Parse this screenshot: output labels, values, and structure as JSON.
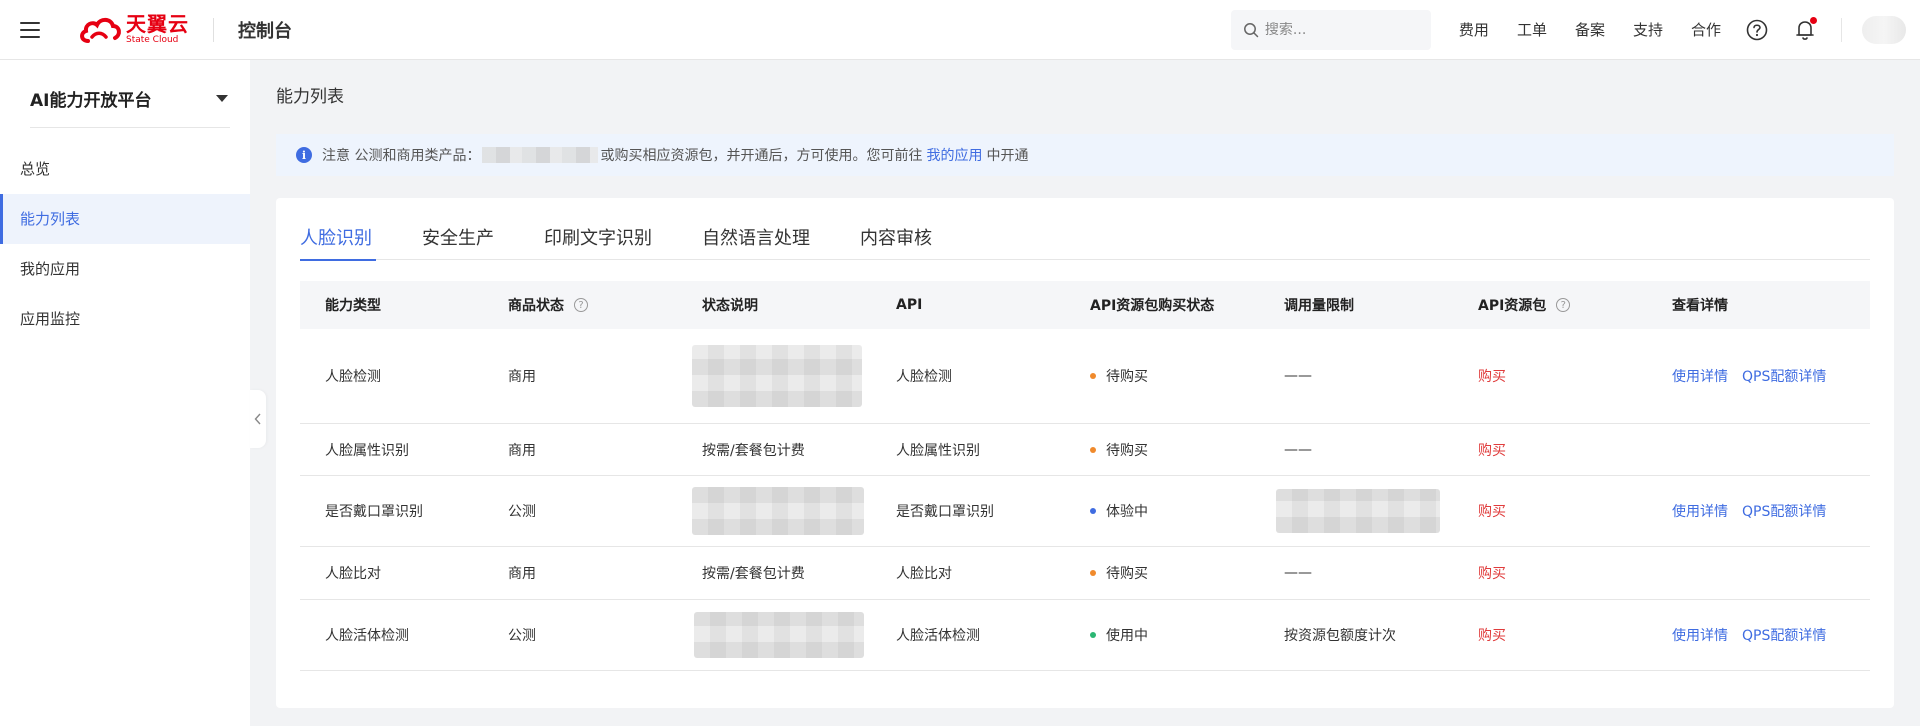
{
  "topbar": {
    "logo_cn": "天翼云",
    "logo_en": "State Cloud",
    "console_title": "控制台",
    "search_placeholder": "搜索...",
    "nav": [
      "费用",
      "工单",
      "备案",
      "支持",
      "合作"
    ],
    "icons": [
      "help-icon",
      "bell-icon"
    ]
  },
  "sidebar": {
    "platform_title": "AI能力开放平台",
    "items": [
      {
        "label": "总览",
        "active": false
      },
      {
        "label": "能力列表",
        "active": true
      },
      {
        "label": "我的应用",
        "active": false
      },
      {
        "label": "应用监控",
        "active": false
      }
    ]
  },
  "page": {
    "title": "能力列表",
    "notice": {
      "prefix": "注意 公测和商用类产品：",
      "middle": "或购买相应资源包，并开通后，方可使用。您可前往",
      "link": "我的应用",
      "suffix": "中开通"
    }
  },
  "tabs": [
    {
      "label": "人脸识别",
      "active": true
    },
    {
      "label": "安全生产",
      "active": false
    },
    {
      "label": "印刷文字识别",
      "active": false
    },
    {
      "label": "自然语言处理",
      "active": false
    },
    {
      "label": "内容审核",
      "active": false
    }
  ],
  "table": {
    "columns": [
      "能力类型",
      "商品状态",
      "状态说明",
      "API",
      "API资源包购买状态",
      "调用量限制",
      "API资源包",
      "查看详情"
    ],
    "rows": [
      {
        "type": "人脸检测",
        "status": "商用",
        "desc": "",
        "api": "人脸检测",
        "buy_status": "待购买",
        "dot": "orange",
        "limit": "——",
        "pkg": "购买",
        "detail1": "使用详情",
        "detail2": "QPS配额详情"
      },
      {
        "type": "人脸属性识别",
        "status": "商用",
        "desc": "按需/套餐包计费",
        "api": "人脸属性识别",
        "buy_status": "待购买",
        "dot": "orange",
        "limit": "——",
        "pkg": "购买",
        "detail1": "",
        "detail2": ""
      },
      {
        "type": "是否戴口罩识别",
        "status": "公测",
        "desc": "",
        "api": "是否戴口罩识别",
        "buy_status": "体验中",
        "dot": "blue",
        "limit": "",
        "pkg": "购买",
        "detail1": "使用详情",
        "detail2": "QPS配额详情"
      },
      {
        "type": "人脸比对",
        "status": "商用",
        "desc": "按需/套餐包计费",
        "api": "人脸比对",
        "buy_status": "待购买",
        "dot": "orange",
        "limit": "——",
        "pkg": "购买",
        "detail1": "",
        "detail2": ""
      },
      {
        "type": "人脸活体检测",
        "status": "公测",
        "desc": "",
        "api": "人脸活体检测",
        "buy_status": "使用中",
        "dot": "green",
        "limit": "按资源包额度计次",
        "pkg": "购买",
        "detail1": "使用详情",
        "detail2": "QPS配额详情"
      }
    ]
  }
}
